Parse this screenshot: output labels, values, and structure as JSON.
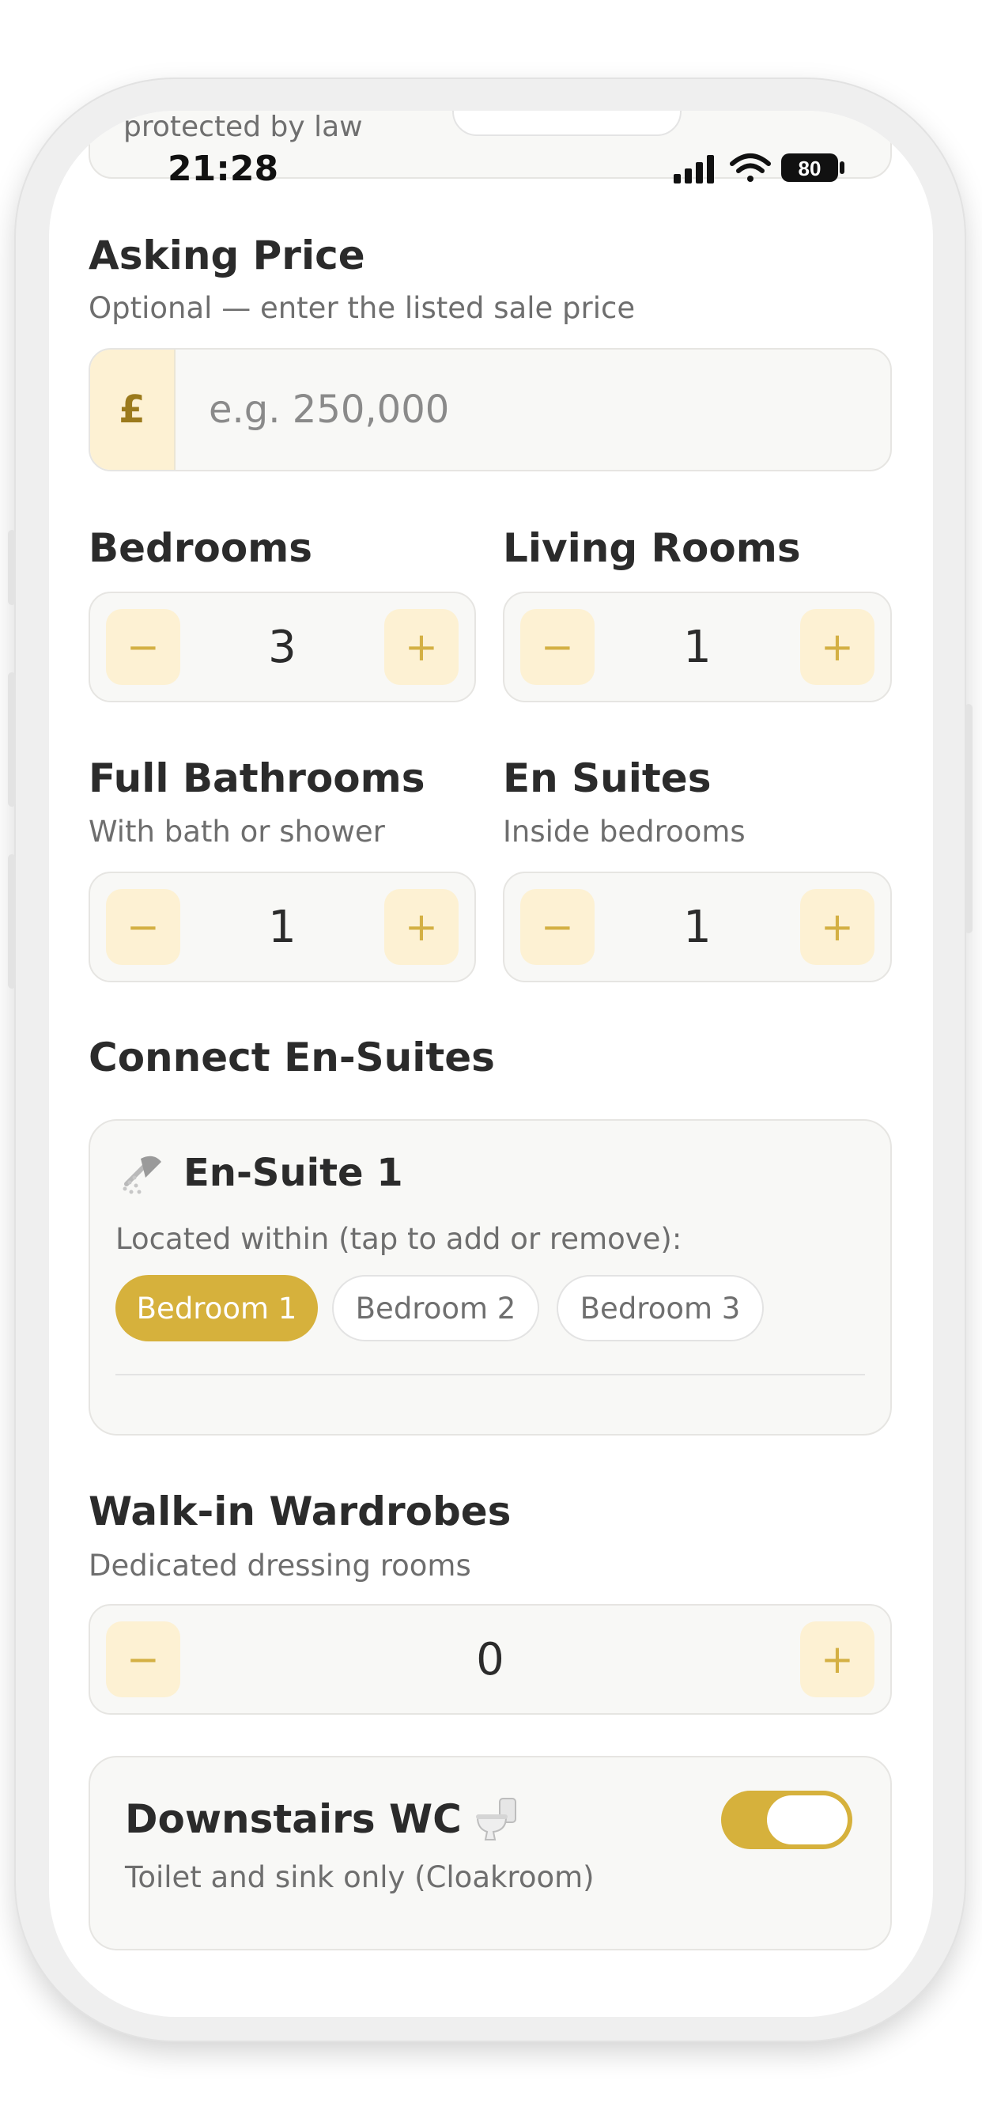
{
  "status_bar": {
    "time": "21:28",
    "battery": "80"
  },
  "previous": {
    "text": "protected by law"
  },
  "asking_price": {
    "title": "Asking Price",
    "subtitle": "Optional — enter the listed sale price",
    "currency": "£",
    "placeholder": "e.g. 250,000"
  },
  "bedrooms": {
    "label": "Bedrooms",
    "value": "3"
  },
  "living_rooms": {
    "label": "Living Rooms",
    "value": "1"
  },
  "full_bathrooms": {
    "label": "Full Bathrooms",
    "subtitle": "With bath or shower",
    "value": "1"
  },
  "en_suites": {
    "label": "En Suites",
    "subtitle": "Inside bedrooms",
    "value": "1"
  },
  "stepper": {
    "minus": "−",
    "plus": "+"
  },
  "connect": {
    "title": "Connect En-Suites",
    "card_title": "En-Suite 1",
    "card_icon": "shower-icon",
    "prompt": "Located within (tap to add or remove):",
    "chips": [
      {
        "label": "Bedroom 1",
        "selected": true
      },
      {
        "label": "Bedroom 2",
        "selected": false
      },
      {
        "label": "Bedroom 3",
        "selected": false
      }
    ]
  },
  "walk_in": {
    "title": "Walk-in Wardrobes",
    "subtitle": "Dedicated dressing rooms",
    "value": "0"
  },
  "downstairs_wc": {
    "title": "Downstairs WC",
    "icon": "toilet-icon",
    "subtitle": "Toilet and sink only (Cloakroom)",
    "toggle_on": true
  },
  "colors": {
    "accent": "#d6b13c",
    "accent_soft": "#fdf1d3",
    "card_bg": "#f8f8f6",
    "text": "#2b2b2b",
    "muted": "#6e6e6e"
  }
}
